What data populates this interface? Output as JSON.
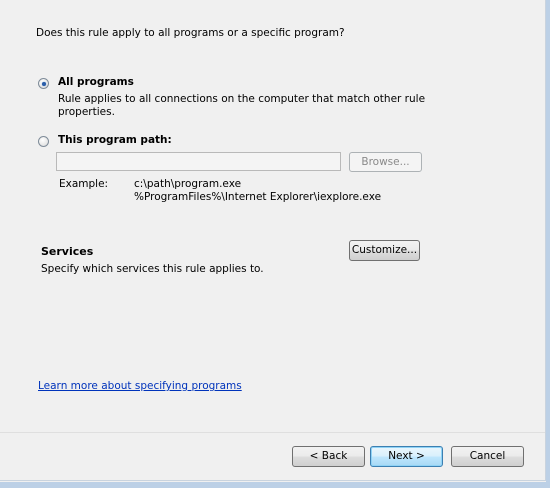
{
  "question": "Does this rule apply to all programs or a specific program?",
  "all_programs": {
    "label": "All programs",
    "checked": true,
    "description_line1": "Rule applies to all connections on the computer that match other rule",
    "description_line2": "properties."
  },
  "program_path": {
    "label": "This program path:",
    "checked": false,
    "value": "",
    "browse_label": "Browse...",
    "example_label": "Example:",
    "example_line1": "c:\\path\\program.exe",
    "example_line2": "%ProgramFiles%\\Internet Explorer\\iexplore.exe"
  },
  "services": {
    "title": "Services",
    "description": "Specify which services this rule applies to.",
    "customize_label": "Customize..."
  },
  "learn_more_link": "Learn more about specifying programs",
  "footer": {
    "back_label": "< Back",
    "next_label": "Next >",
    "cancel_label": "Cancel"
  }
}
